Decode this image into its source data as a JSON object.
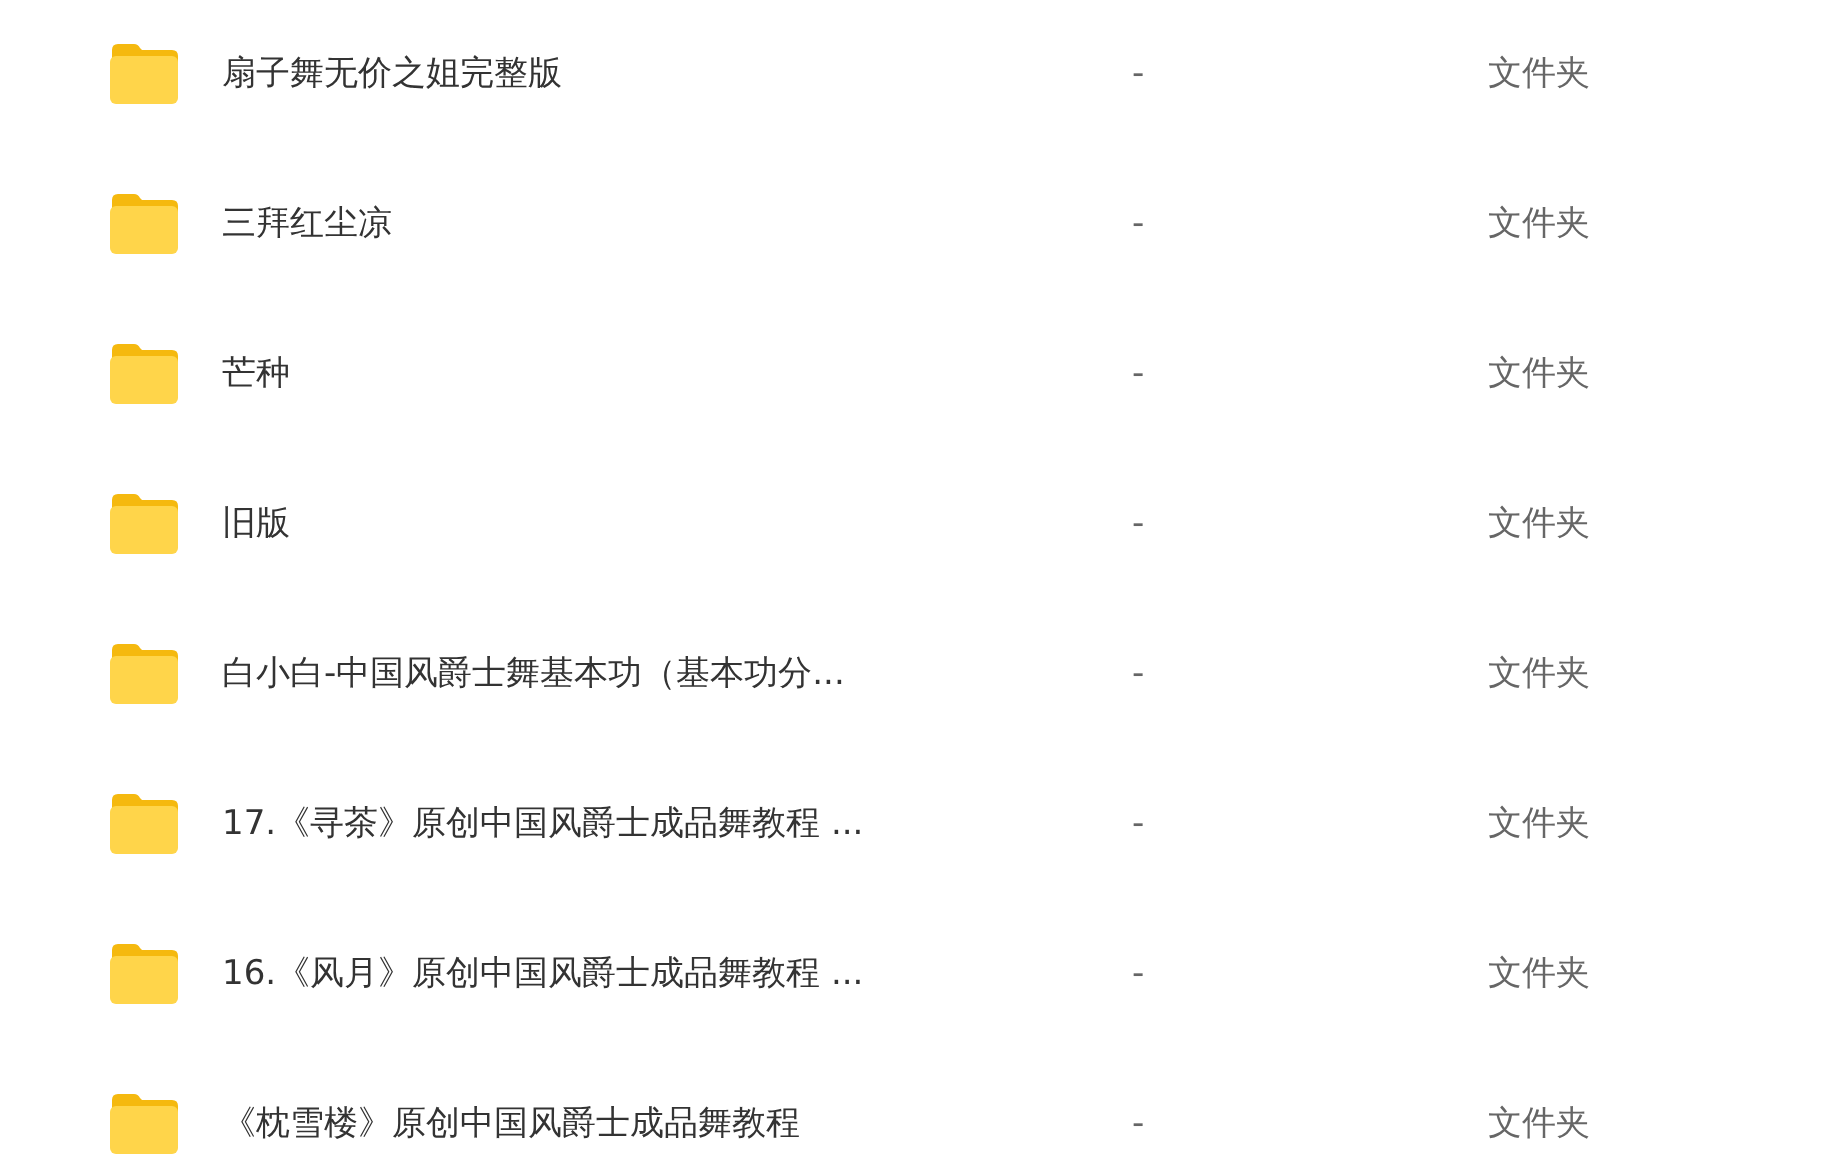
{
  "files": [
    {
      "name": "扇子舞无价之姐完整版",
      "size": "-",
      "type": "文件夹"
    },
    {
      "name": "三拜红尘凉",
      "size": "-",
      "type": "文件夹"
    },
    {
      "name": "芒种",
      "size": "-",
      "type": "文件夹"
    },
    {
      "name": "旧版",
      "size": "-",
      "type": "文件夹"
    },
    {
      "name": "白小白-中国风爵士舞基本功（基本功分...",
      "size": "-",
      "type": "文件夹"
    },
    {
      "name": "17.《寻茶》原创中国风爵士成品舞教程 ...",
      "size": "-",
      "type": "文件夹"
    },
    {
      "name": "16.《风月》原创中国风爵士成品舞教程 ...",
      "size": "-",
      "type": "文件夹"
    },
    {
      "name": "《枕雪楼》原创中国风爵士成品舞教程",
      "size": "-",
      "type": "文件夹"
    }
  ]
}
